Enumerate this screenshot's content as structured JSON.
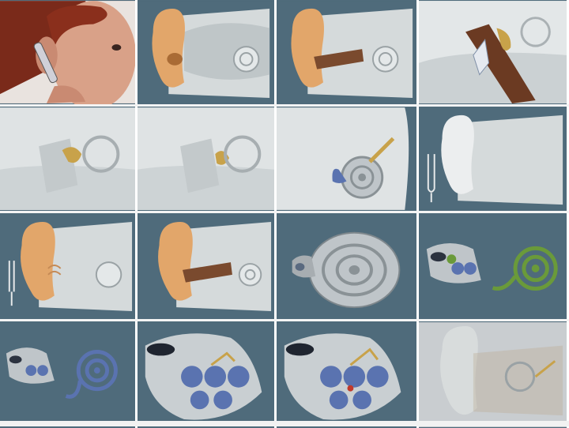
{
  "colors": {
    "tile_background": "#4f6b7b",
    "skin": "#e2a66a",
    "ear_canal": "#7a4a2e",
    "bone": "#d8dcdc",
    "cochlea": "#bfc5c9",
    "fluid_blue": "#5a73b0",
    "hair_cell_green": "#6a9a3a",
    "ossicle_gold": "#c8a24a"
  },
  "tiles": [
    {
      "icon": "woman-with-phone"
    },
    {
      "icon": "outer-ear"
    },
    {
      "icon": "ear-canal"
    },
    {
      "icon": "eardrum-closeup"
    },
    {
      "icon": "middle-ear-ossicles"
    },
    {
      "icon": "ossicles-detail"
    },
    {
      "icon": "cochlea-with-ossicles"
    },
    {
      "icon": "tuning-fork-ear"
    },
    {
      "icon": "ear-with-tuning-fork"
    },
    {
      "icon": "ear-canal-vibration"
    },
    {
      "icon": "cochlea-spiral"
    },
    {
      "icon": "cochlea-cross-section-uncoiled"
    },
    {
      "icon": "cochlea-uncoiled-blue"
    },
    {
      "icon": "organ-of-corti"
    },
    {
      "icon": "organ-of-corti-hair-cells"
    },
    {
      "icon": "faded-ear-overlay"
    }
  ]
}
